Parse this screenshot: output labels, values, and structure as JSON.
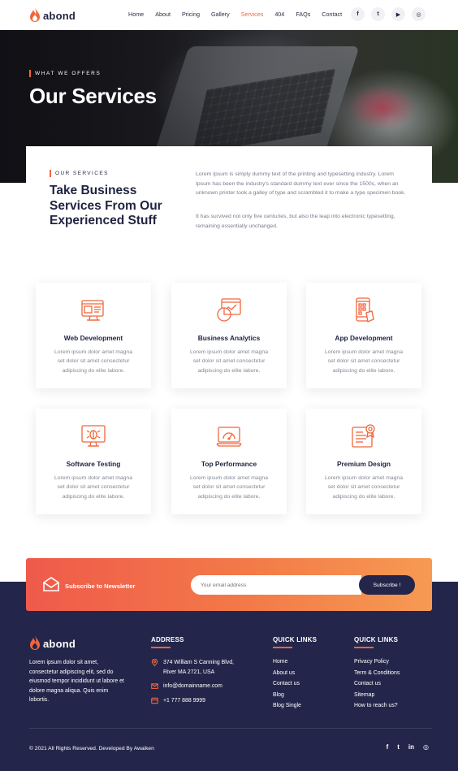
{
  "brand": {
    "name": "abond",
    "accent": "#f0663c",
    "dark": "#23264a"
  },
  "nav": {
    "items": [
      "Home",
      "About",
      "Pricing",
      "Gallery",
      "Services",
      "404",
      "FAQs",
      "Contact"
    ],
    "active": "Services"
  },
  "social_icons": [
    "facebook-icon",
    "twitter-icon",
    "youtube-icon",
    "instagram-icon"
  ],
  "social_glyphs": [
    "f",
    "t",
    "▶",
    "◎"
  ],
  "hero": {
    "kicker": "WHAT WE OFFERS",
    "title": "Our Services"
  },
  "intro": {
    "kicker": "OUR SERVICES",
    "title": "Take Business Services From Our Experienced Stuff",
    "paragraph1": "Lorem Ipsum is simply dummy text of the printing and typesetting industry. Lorem Ipsum has been the industry's standard dummy text ever since the 1500s, when an unknown printer took a galley of type and scrambled it to make a type specimen book.",
    "paragraph2": "It has survived not only five centuries, but also the leap into electronic typesetting, remaining essentially unchanged."
  },
  "services": [
    {
      "title": "Web Development",
      "desc": "Lorem ipsum dolor amet magna set dolor sit amet consectetur adipiscing do elite labore.",
      "icon": "web-development-icon"
    },
    {
      "title": "Business Analytics",
      "desc": "Lorem ipsum dolor amet magna set dolor sit amet consectetur adipiscing do elite labore.",
      "icon": "analytics-icon"
    },
    {
      "title": "App Development",
      "desc": "Lorem ipsum dolor amet magna set dolor sit amet consectetur adipiscing do elite labore.",
      "icon": "mobile-app-icon"
    },
    {
      "title": "Software Testing",
      "desc": "Lorem ipsum dolor amet magna set dolor sit amet consectetur adipiscing do elite labore.",
      "icon": "bug-testing-icon"
    },
    {
      "title": "Top Performance",
      "desc": "Lorem ipsum dolor amet magna set dolor sit amet consectetur adipiscing do elite labore.",
      "icon": "speedometer-icon"
    },
    {
      "title": "Premium Design",
      "desc": "Lorem ipsum dolor amet magna set dolor sit amet consectetur adipiscing do elite labore.",
      "icon": "design-certificate-icon"
    }
  ],
  "newsletter": {
    "label": "Subscribe to Newsletter",
    "placeholder": "Your email address",
    "button": "Subscribe !"
  },
  "footer": {
    "about": "Lorem ipsum dolor sit amet, consectetur adipiscing elit, sed do eiusmod tempor incididunt ut labore et dolore magna aliqua. Quis enim lobortis.",
    "address_title": "ADDRESS",
    "address": "374 William S Canning Blvd, River MA 2721, USA",
    "email": "info@domainname.com",
    "phone": "+1 777 888 9999",
    "quick_links_1_title": "QUICK LINKS",
    "quick_links_1": [
      "Home",
      "About us",
      "Contact us",
      "Blog",
      "Blog Single"
    ],
    "quick_links_2_title": "QUICK LINKS",
    "quick_links_2": [
      "Privacy Policy",
      "Term & Conditions",
      "Contact us",
      "Sitemap",
      "How to reach us?"
    ],
    "copyright": "© 2021 All Rights Reserved. Developed By Awaiken",
    "social_glyphs": [
      "f",
      "t",
      "in",
      "◎"
    ]
  }
}
